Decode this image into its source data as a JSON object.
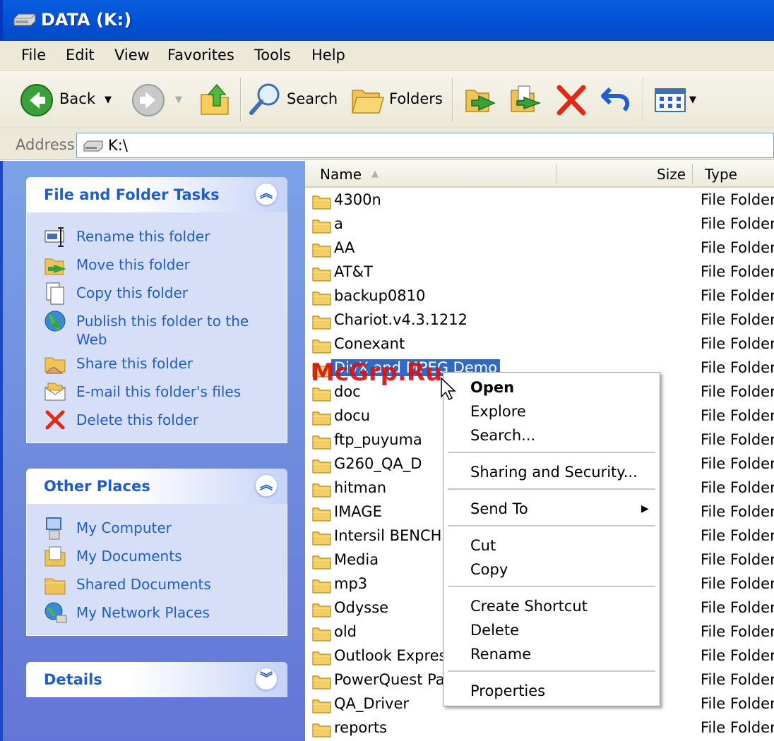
{
  "window": {
    "title": "DATA (K:)"
  },
  "menu": [
    "File",
    "Edit",
    "View",
    "Favorites",
    "Tools",
    "Help"
  ],
  "toolbar": {
    "back_label": "Back",
    "search_label": "Search",
    "folders_label": "Folders"
  },
  "address": {
    "label": "Address",
    "value": "K:\\"
  },
  "tasks_panel": {
    "title": "File and Folder Tasks",
    "items": [
      {
        "label": "Rename this folder",
        "icon": "rename-icon"
      },
      {
        "label": "Move this folder",
        "icon": "move-icon"
      },
      {
        "label": "Copy this folder",
        "icon": "copy-icon"
      },
      {
        "label": "Publish this folder to the Web",
        "icon": "globe-icon"
      },
      {
        "label": "Share this folder",
        "icon": "share-icon"
      },
      {
        "label": "E-mail this folder's files",
        "icon": "email-icon"
      },
      {
        "label": "Delete this folder",
        "icon": "delete-icon"
      }
    ]
  },
  "places_panel": {
    "title": "Other Places",
    "items": [
      {
        "label": "My Computer",
        "icon": "computer-icon"
      },
      {
        "label": "My Documents",
        "icon": "documents-icon"
      },
      {
        "label": "Shared Documents",
        "icon": "folder-icon"
      },
      {
        "label": "My Network Places",
        "icon": "network-icon"
      }
    ]
  },
  "details_panel": {
    "title": "Details"
  },
  "columns": {
    "name": "Name",
    "size": "Size",
    "type": "Type"
  },
  "files": [
    {
      "name": "4300n",
      "type": "File Folder"
    },
    {
      "name": "a",
      "type": "File Folder"
    },
    {
      "name": "AA",
      "type": "File Folder"
    },
    {
      "name": "AT&T",
      "type": "File Folder"
    },
    {
      "name": "backup0810",
      "type": "File Folder"
    },
    {
      "name": "Chariot.v4.3.1212",
      "type": "File Folder"
    },
    {
      "name": "Conexant",
      "type": "File Folder"
    },
    {
      "name": "DivX and MPEG Demo",
      "type": "File Folder"
    },
    {
      "name": "doc",
      "type": "File Folder"
    },
    {
      "name": "docu",
      "type": "File Folder"
    },
    {
      "name": "ftp_puyuma",
      "type": "File Folder"
    },
    {
      "name": "G260_QA_D",
      "type": "File Folder"
    },
    {
      "name": "hitman",
      "type": "File Folder"
    },
    {
      "name": "IMAGE",
      "type": "File Folder"
    },
    {
      "name": "Intersil BENCHM",
      "type": "File Folder"
    },
    {
      "name": "Media",
      "type": "File Folder"
    },
    {
      "name": "mp3",
      "type": "File Folder"
    },
    {
      "name": "Odysse",
      "type": "File Folder"
    },
    {
      "name": "old",
      "type": "File Folder"
    },
    {
      "name": "Outlook Express",
      "type": "File Folder"
    },
    {
      "name": "PowerQuest Par",
      "type": "File Folder"
    },
    {
      "name": "QA_Driver",
      "type": "File Folder"
    },
    {
      "name": "reports",
      "type": "File Folder"
    }
  ],
  "context_menu": {
    "open": "Open",
    "explore": "Explore",
    "search": "Search...",
    "sharing": "Sharing and Security...",
    "send_to": "Send To",
    "cut": "Cut",
    "copy": "Copy",
    "create_shortcut": "Create Shortcut",
    "delete": "Delete",
    "rename": "Rename",
    "properties": "Properties"
  },
  "watermark": "McGrp.Ru"
}
